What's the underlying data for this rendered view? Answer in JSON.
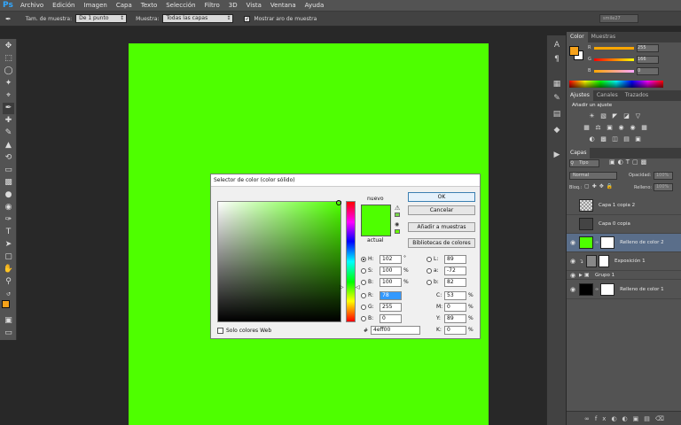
{
  "app": {
    "logo": "Ps"
  },
  "menu": [
    "Archivo",
    "Edición",
    "Imagen",
    "Capa",
    "Texto",
    "Selección",
    "Filtro",
    "3D",
    "Vista",
    "Ventana",
    "Ayuda"
  ],
  "options": {
    "tool_icon": "eyedropper-icon",
    "sample_size_label": "Tam. de muestra:",
    "sample_size_value": "De 1 punto",
    "sample_label": "Muestra:",
    "sample_value": "Todas las capas",
    "show_ring_label": "Mostrar aro de muestra",
    "show_ring_checked": true,
    "workspace": "smile27"
  },
  "colors": {
    "canvas": "#4eff00",
    "accent": "#31a8ff",
    "foreground": "#f6a21a",
    "background": "#ffffff"
  },
  "color_panel": {
    "tabs": [
      "Color",
      "Muestras"
    ],
    "channels": [
      {
        "label": "R",
        "value": "255"
      },
      {
        "label": "G",
        "value": "166"
      },
      {
        "label": "B",
        "value": "0"
      }
    ]
  },
  "adjust_panel": {
    "tabs": [
      "Ajustes",
      "Canales",
      "Trazados"
    ],
    "heading": "Añadir un ajuste"
  },
  "layers_panel": {
    "tab": "Capas",
    "filter": "Tipo",
    "blend_mode": "Normal",
    "opacity_label": "Opacidad:",
    "opacity_value": "100%",
    "lock_label": "Bloq.:",
    "fill_label": "Relleno:",
    "fill_value": "100%",
    "layers": [
      {
        "name": "Capa 1 copia 2",
        "visible": false,
        "selected": false
      },
      {
        "name": "Capa 0 copia",
        "visible": false,
        "selected": false
      },
      {
        "name": "Relleno de color 2",
        "visible": true,
        "selected": true
      },
      {
        "name": "Exposición 1",
        "visible": true,
        "selected": false
      },
      {
        "name": "Grupo 1",
        "visible": true,
        "selected": false
      },
      {
        "name": "Relleno de color 1",
        "visible": true,
        "selected": false
      }
    ]
  },
  "dialog": {
    "title": "Selector de color (color sólido)",
    "new_label": "nuevo",
    "current_label": "actual",
    "ok": "OK",
    "cancel": "Cancelar",
    "add_swatch": "Añadir a muestras",
    "libraries": "Bibliotecas de colores",
    "web_only_label": "Solo colores Web",
    "hsb": {
      "H": "102",
      "S": "100",
      "B": "100"
    },
    "rgb": {
      "R": "78",
      "G": "255",
      "B": "0"
    },
    "lab": {
      "L": "89",
      "a": "-72",
      "b": "82"
    },
    "cmyk": {
      "C": "53",
      "M": "0",
      "Y": "89",
      "K": "0"
    },
    "hex_label": "#",
    "hex": "4eff00",
    "units": {
      "deg": "°",
      "pct": "%"
    }
  }
}
